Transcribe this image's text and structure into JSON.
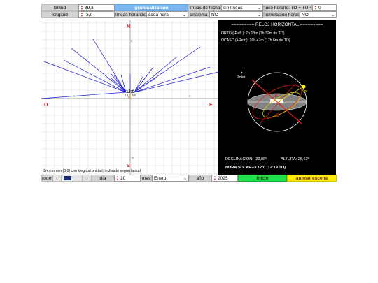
{
  "controls": {
    "latitud": {
      "label": "latitud",
      "value": "39,3"
    },
    "longitud": {
      "label": "longitud",
      "value": "-3,0"
    },
    "geolocalizacion": "geolocalización",
    "lineas_horarias": {
      "label": "líneas horarias",
      "value": "cada hora"
    },
    "lineas_fecha": {
      "label": "líneas de fecha",
      "value": "sin líneas"
    },
    "analema": {
      "label": "analema",
      "value": "NO"
    },
    "huso_horario": {
      "label": "huso horario: TO = TU +",
      "value": "0"
    },
    "numeracion_horas": {
      "label": "numeración horas",
      "value": "NO"
    }
  },
  "dial": {
    "north": "N",
    "south": "S",
    "east_label": "E",
    "west_label": "O",
    "tick_top": "5",
    "tick_bottom": "-5",
    "tick_left": "-5",
    "tick_right": "5",
    "origin_tick": "0",
    "hour_label": "12:0",
    "gnomon_note": "Gnomon en (0,0) con longitud unidad, inclinado según latitud"
  },
  "info_panel": {
    "title": "========= RELOJ HORIZONTAL =========",
    "orto": "ORTO (-Refr.):  7h 13m (7h 32m de TO)",
    "ocaso": "OCASO (+Refr.):  16h 47m  (17h 6m de TO)",
    "polar_label": "Polar",
    "sol_label": "Sol",
    "e_label": "E",
    "o_label": "O",
    "n_label": "N",
    "s_label": "S",
    "declinacion": "DECLINACIÓN: -22,08º",
    "altura": "ALTURA: 28,62º",
    "hora_solar": "HORA SOLAR--> 12:0 (12:19 TO)"
  },
  "bottom": {
    "zoom_label": "zoom",
    "dia_label": "día",
    "dia_value": "10",
    "mes_label": "mes",
    "mes_value": "Enero",
    "ano_label": "año",
    "ano_value": "2025",
    "inicio": "inicio",
    "animar": "animar escena"
  },
  "colors": {
    "hour_lines": "#1a1ad6",
    "cardinal_red": "#e02020",
    "grid": "#d8d8d8",
    "axis": "#777777",
    "panel_bg": "#000000",
    "sun": "#ffff00"
  },
  "icons": {
    "spinner": "up-down-arrows-icon",
    "dropdown": "chevron-down-icon",
    "zoom_out": "chevron-left-icon",
    "zoom_in": "chevron-right-icon"
  }
}
